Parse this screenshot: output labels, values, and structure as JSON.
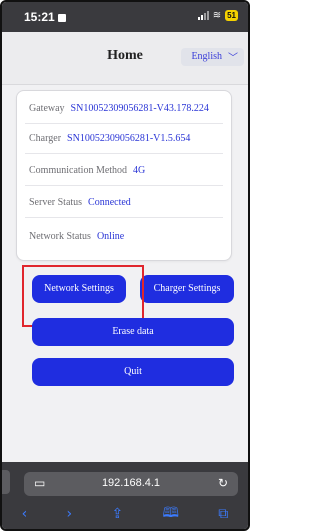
{
  "status_bar": {
    "time": "15:21",
    "battery": "51"
  },
  "header": {
    "title": "Home",
    "language": "English"
  },
  "info": [
    {
      "key": "Gateway",
      "value": "SN10052309056281-V43.178.224"
    },
    {
      "key": "Charger",
      "value": "SN10052309056281-V1.5.654"
    },
    {
      "key": "Communication Method",
      "value": "4G"
    },
    {
      "key": "Server Status",
      "value": "Connected"
    },
    {
      "key": "Network Status",
      "value": "Online"
    }
  ],
  "buttons": {
    "network_settings": "Network Settings",
    "charger_settings": "Charger Settings",
    "erase_data": "Erase data",
    "quit": "Quit"
  },
  "browser": {
    "url": "192.168.4.1"
  },
  "colors": {
    "accent": "#1f2de0",
    "link": "#2a35d6",
    "highlight": "#e0262d"
  }
}
